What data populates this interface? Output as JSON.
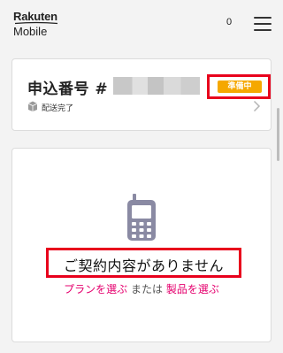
{
  "header": {
    "logo_word": "Rakuten",
    "logo_sub": "Mobile",
    "cart_count": "0",
    "menu_icon": "hamburger-menu-icon"
  },
  "order": {
    "label": "申込番号 #",
    "status": "準備中",
    "status_color": "#f5a800",
    "delivery_icon": "delivery-box-icon",
    "delivery_status": "配送完了",
    "chevron_icon": "chevron-right-icon"
  },
  "contract": {
    "icon": "mobile-phone-icon",
    "empty_message": "ご契約内容がありません",
    "plan_link": "プランを選ぶ",
    "connector": " または ",
    "product_link": "製品を選ぶ",
    "link_color": "#e5006e"
  },
  "colors": {
    "highlight_border": "#e8001c",
    "background": "#f3f3f3"
  }
}
